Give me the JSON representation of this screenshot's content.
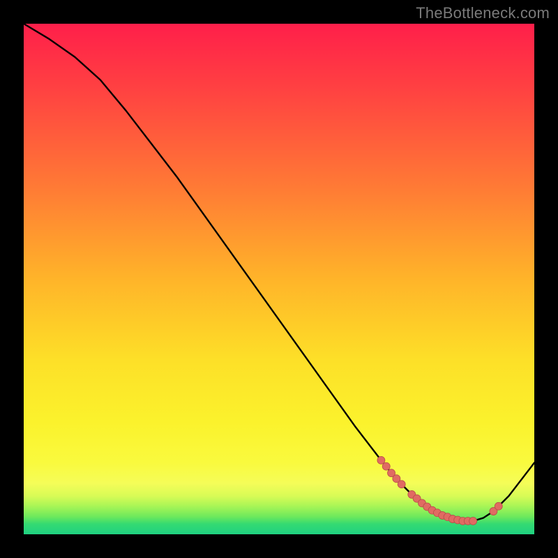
{
  "watermark": "TheBottleneck.com",
  "colors": {
    "background": "#000000",
    "curve": "#000000",
    "marker_fill": "#e06b62",
    "marker_stroke": "#b84d49"
  },
  "chart_data": {
    "type": "line",
    "title": "",
    "xlabel": "",
    "ylabel": "",
    "xlim": [
      0,
      100
    ],
    "ylim": [
      0,
      100
    ],
    "grid": false,
    "legend": false,
    "series": [
      {
        "name": "curve",
        "x": [
          0,
          5,
          10,
          15,
          20,
          25,
          30,
          35,
          40,
          45,
          50,
          55,
          60,
          65,
          70,
          72,
          74,
          76,
          78,
          80,
          82,
          84,
          86,
          88,
          90,
          92,
          95,
          100
        ],
        "y": [
          100,
          97,
          93.5,
          89,
          83,
          76.5,
          70,
          63,
          56,
          49,
          42,
          35,
          28,
          21,
          14.5,
          12,
          9.8,
          7.8,
          6.1,
          4.7,
          3.7,
          3.0,
          2.6,
          2.6,
          3.2,
          4.5,
          7.5,
          14
        ]
      }
    ],
    "markers": [
      {
        "x": 70.0,
        "y": 14.5
      },
      {
        "x": 71.0,
        "y": 13.3
      },
      {
        "x": 72.0,
        "y": 12.0
      },
      {
        "x": 73.0,
        "y": 10.9
      },
      {
        "x": 74.0,
        "y": 9.8
      },
      {
        "x": 76.0,
        "y": 7.8
      },
      {
        "x": 77.0,
        "y": 7.0
      },
      {
        "x": 78.0,
        "y": 6.1
      },
      {
        "x": 79.0,
        "y": 5.4
      },
      {
        "x": 80.0,
        "y": 4.7
      },
      {
        "x": 81.0,
        "y": 4.2
      },
      {
        "x": 82.0,
        "y": 3.7
      },
      {
        "x": 83.0,
        "y": 3.4
      },
      {
        "x": 84.0,
        "y": 3.0
      },
      {
        "x": 85.0,
        "y": 2.8
      },
      {
        "x": 86.0,
        "y": 2.6
      },
      {
        "x": 87.0,
        "y": 2.6
      },
      {
        "x": 88.0,
        "y": 2.6
      },
      {
        "x": 92.0,
        "y": 4.5
      },
      {
        "x": 93.0,
        "y": 5.5
      }
    ],
    "marker_radius": 5.5
  }
}
